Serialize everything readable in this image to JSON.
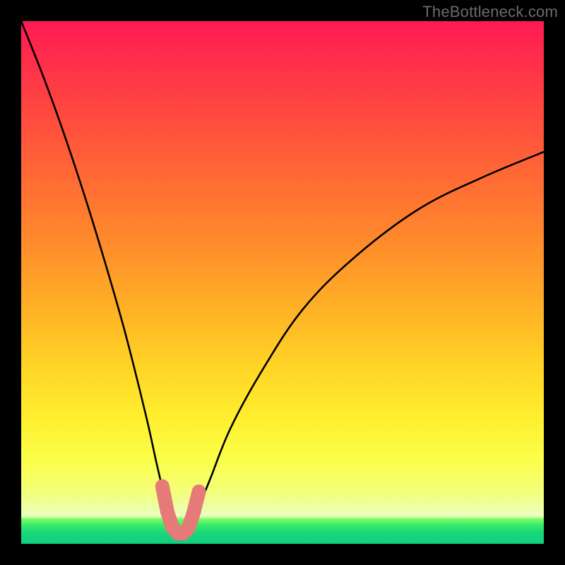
{
  "watermark": "TheBottleneck.com",
  "colors": {
    "background": "#000000",
    "curve": "#000000",
    "marker": "#e57a78",
    "gradient_top": "#ff1a53",
    "gradient_mid": "#ffd426",
    "gradient_bottom": "#11cf7e"
  },
  "chart_data": {
    "type": "line",
    "title": "",
    "xlabel": "",
    "ylabel": "",
    "xlim": [
      0,
      100
    ],
    "ylim": [
      0,
      100
    ],
    "notes": "V-shaped bottleneck curve. x ≈ normalized component balance (0–100). y ≈ bottleneck severity (0 = none/green, 100 = severe/red). Minimum near x≈30 where bottleneck ≈0. Left branch rises steeply to ~100 at x=0; right branch rises with diminishing slope to ~75 at x=100.",
    "series": [
      {
        "name": "bottleneck-curve",
        "x": [
          0,
          4,
          8,
          12,
          16,
          20,
          24,
          26,
          28,
          30,
          31,
          33,
          36,
          40,
          46,
          54,
          64,
          76,
          88,
          100
        ],
        "values": [
          100,
          90,
          79,
          67,
          54,
          40,
          24,
          15,
          7,
          2,
          2,
          5,
          12,
          22,
          33,
          45,
          55,
          64,
          70,
          75
        ]
      }
    ],
    "marker": {
      "name": "optimal-range",
      "x": [
        27,
        28,
        29,
        30,
        31,
        32,
        33,
        34
      ],
      "values": [
        11,
        6,
        3,
        2,
        2,
        3,
        6,
        10
      ],
      "style": "thick-rounded"
    }
  }
}
